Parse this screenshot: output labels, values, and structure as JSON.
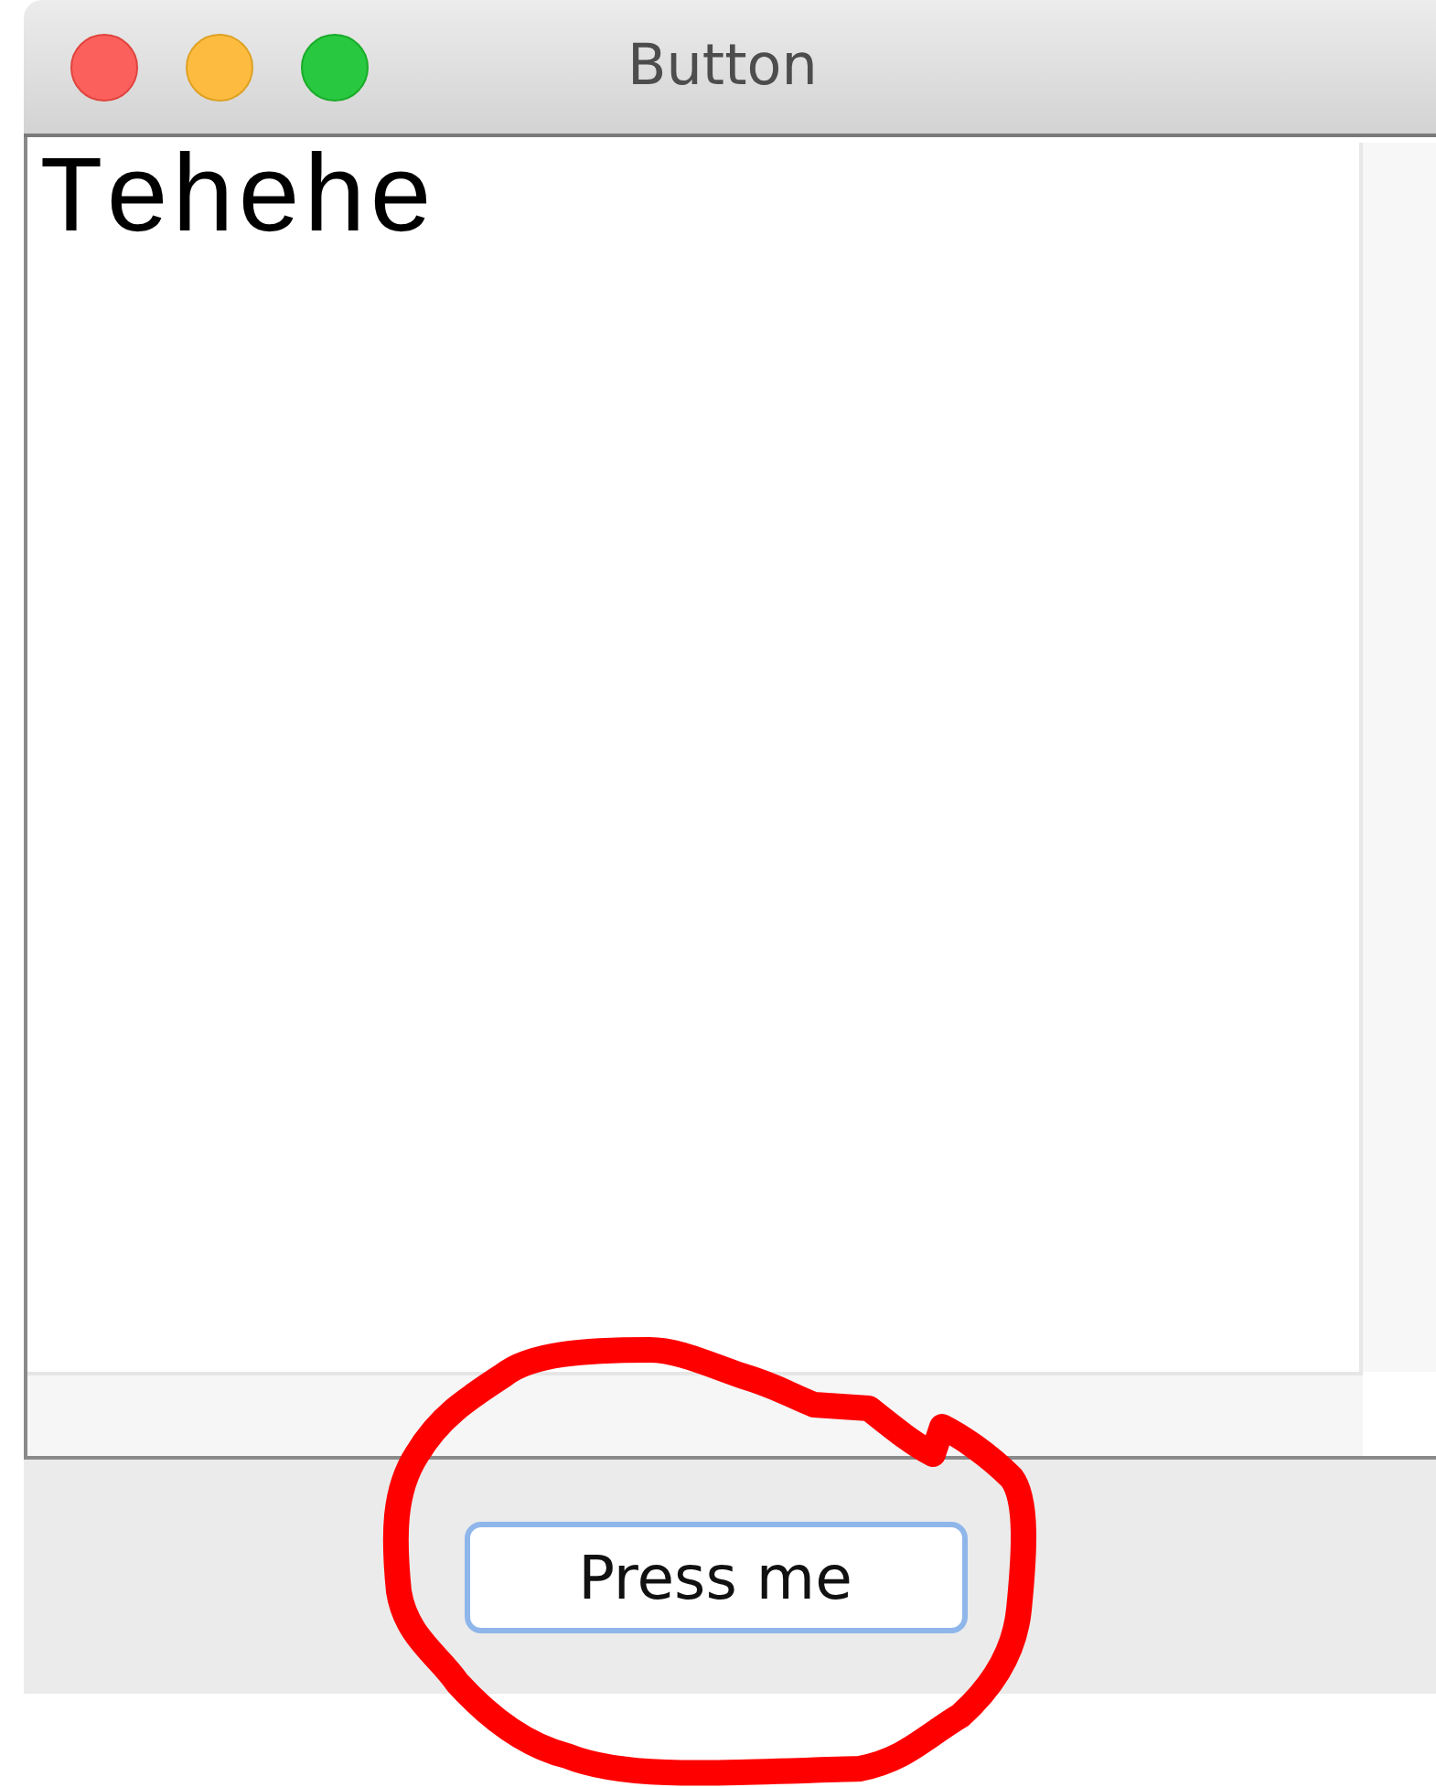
{
  "window": {
    "title": "Button"
  },
  "text_area": {
    "value": "Tehehe"
  },
  "button": {
    "label": "Press me"
  }
}
